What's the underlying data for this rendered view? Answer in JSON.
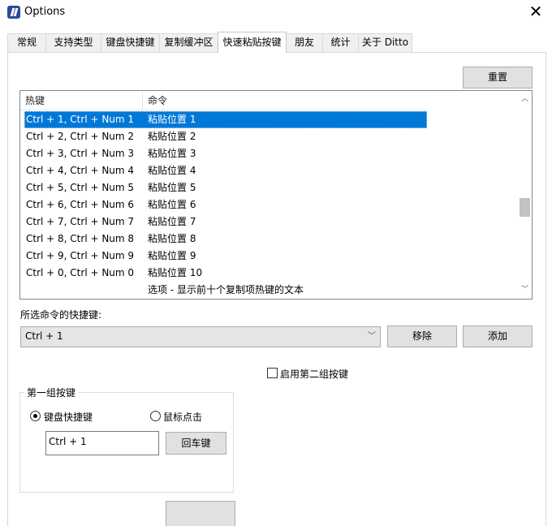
{
  "window": {
    "title": "Options"
  },
  "tabs": [
    {
      "label": "常规"
    },
    {
      "label": "支持类型"
    },
    {
      "label": "键盘快捷键"
    },
    {
      "label": "复制缓冲区"
    },
    {
      "label": "快速粘贴按键",
      "active": true
    },
    {
      "label": "朋友"
    },
    {
      "label": "统计"
    },
    {
      "label": "关于 Ditto"
    }
  ],
  "reset_label": "重置",
  "list": {
    "columns": [
      "热键",
      "命令"
    ],
    "rows": [
      {
        "hotkey": "Ctrl + 1, Ctrl + Num 1",
        "command": "粘贴位置 1",
        "selected": true
      },
      {
        "hotkey": "Ctrl + 2, Ctrl + Num 2",
        "command": "粘贴位置 2"
      },
      {
        "hotkey": "Ctrl + 3, Ctrl + Num 3",
        "command": "粘贴位置 3"
      },
      {
        "hotkey": "Ctrl + 4, Ctrl + Num 4",
        "command": "粘贴位置 4"
      },
      {
        "hotkey": "Ctrl + 5, Ctrl + Num 5",
        "command": "粘贴位置 5"
      },
      {
        "hotkey": "Ctrl + 6, Ctrl + Num 6",
        "command": "粘贴位置 6"
      },
      {
        "hotkey": "Ctrl + 7, Ctrl + Num 7",
        "command": "粘贴位置 7"
      },
      {
        "hotkey": "Ctrl + 8, Ctrl + Num 8",
        "command": "粘贴位置 8"
      },
      {
        "hotkey": "Ctrl + 9, Ctrl + Num 9",
        "command": "粘贴位置 9"
      },
      {
        "hotkey": "Ctrl + 0, Ctrl + Num 0",
        "command": "粘贴位置 10"
      },
      {
        "hotkey": "",
        "command": "选项 - 显示前十个复制项热键的文本"
      }
    ]
  },
  "selected_command_label": "所选命令的快捷键:",
  "shortcut_combo": {
    "value": "Ctrl + 1"
  },
  "remove_label": "移除",
  "add_label": "添加",
  "enable_second_group": {
    "label": "启用第二组按键",
    "checked": false
  },
  "group1": {
    "title": "第一组按键",
    "radio_keyboard": {
      "label": "键盘快捷键",
      "checked": true
    },
    "radio_mouse": {
      "label": "鼠标点击",
      "checked": false
    },
    "key_value": "Ctrl + 1",
    "enter_label": "回车键"
  }
}
